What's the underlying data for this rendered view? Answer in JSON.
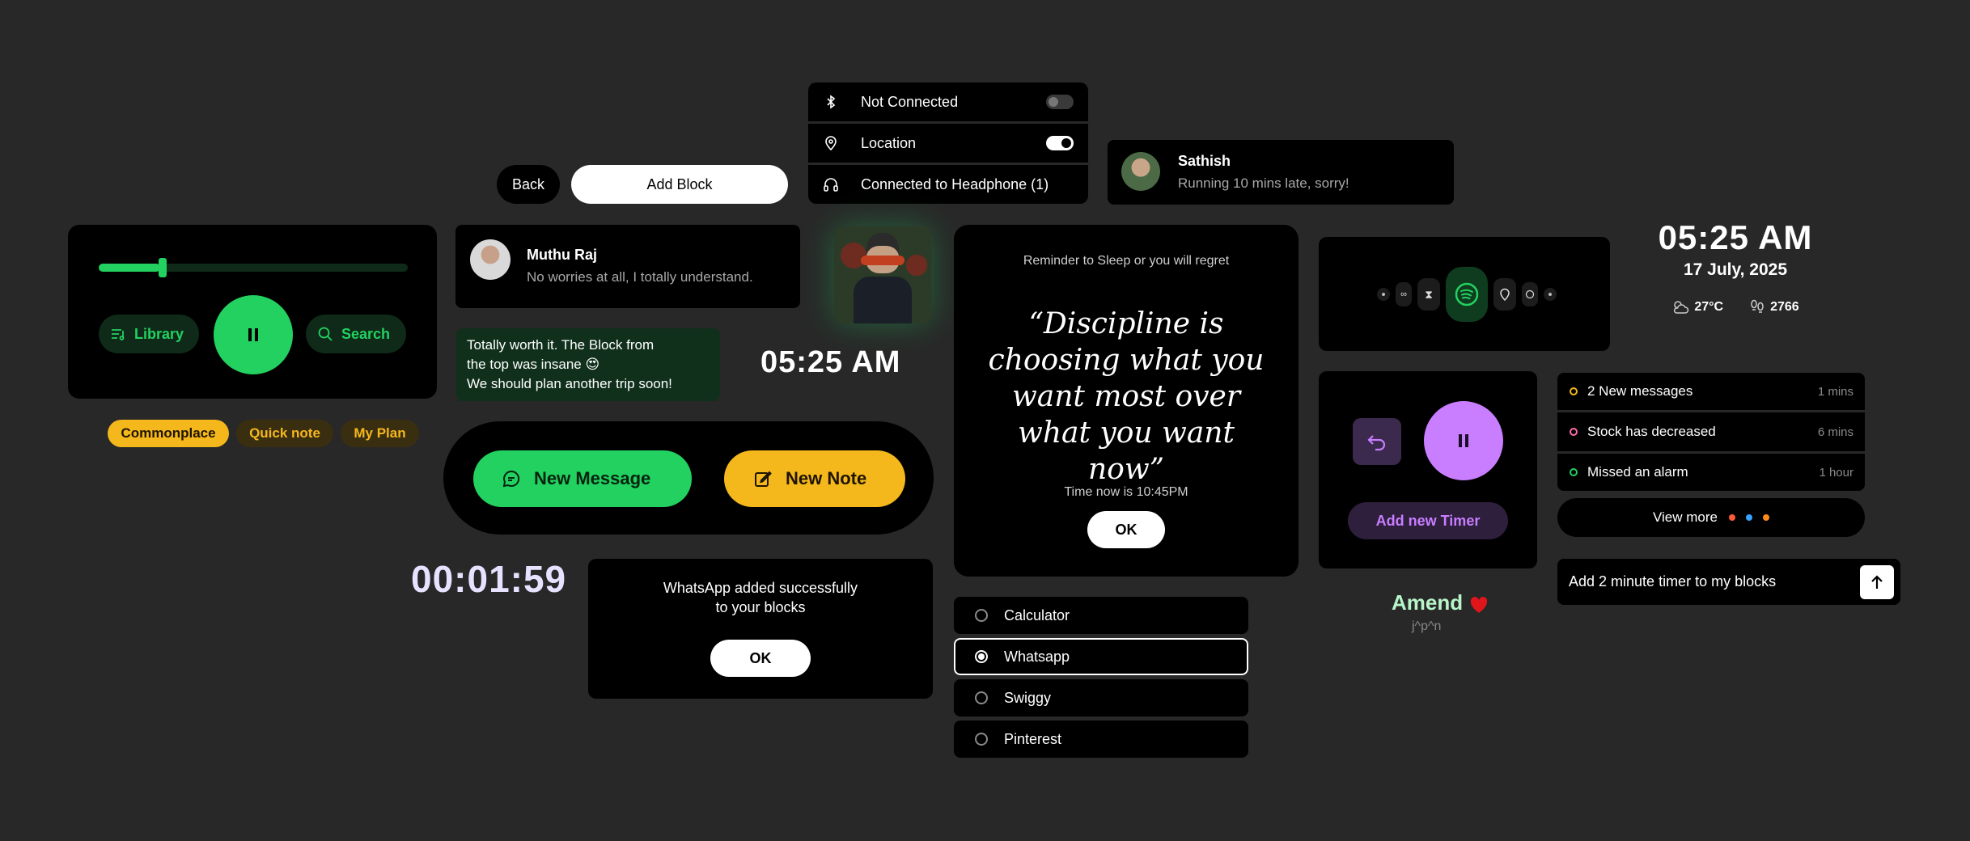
{
  "colors": {
    "accent_green": "#22d160",
    "accent_yellow": "#f5b81c",
    "accent_purple": "#c97dff",
    "bg": "#282828",
    "card": "#000000"
  },
  "top_buttons": {
    "back": "Back",
    "add_block": "Add Block"
  },
  "connectivity": {
    "items": [
      {
        "icon": "bluetooth-icon",
        "label": "Not Connected",
        "toggle": "off"
      },
      {
        "icon": "location-pin-icon",
        "label": "Location",
        "toggle": "on"
      },
      {
        "icon": "headphone-icon",
        "label": "Connected to Headphone (1)"
      }
    ]
  },
  "notification_top": {
    "name": "Sathish",
    "message": "Running 10 mins late, sorry!"
  },
  "music_player": {
    "progress": 0.2,
    "library_label": "Library",
    "search_label": "Search"
  },
  "tags": [
    "Commonplace",
    "Quick note",
    "My Plan"
  ],
  "message_card": {
    "name": "Muthu Raj",
    "message": "No worries at all, I totally understand."
  },
  "green_note": {
    "line1": "Totally worth it. The Block from",
    "line2": "the top was insane 😍",
    "line3": "We should plan another trip soon!"
  },
  "clock_small": "05:25 AM",
  "actions": {
    "new_message": "New Message",
    "new_note": "New Note"
  },
  "stopwatch": "00:01:59",
  "whatsapp_dialog": {
    "line1": "WhatsApp added successfully",
    "line2": "to your blocks",
    "ok": "OK"
  },
  "reminder": {
    "header": "Reminder to Sleep or you will regret",
    "quote": "“Discipline is choosing what you want most over what you want now”",
    "time_text": "Time now is 10:45PM",
    "ok": "OK"
  },
  "app_list": {
    "items": [
      "Calculator",
      "Whatsapp",
      "Swiggy",
      "Pinterest"
    ],
    "selected": "Whatsapp"
  },
  "dock": {
    "icons": [
      "dot-icon",
      "infinity-icon",
      "hourglass-icon",
      "spotify-icon",
      "location-icon",
      "whatsapp-icon",
      "dot-icon"
    ]
  },
  "timer_card": {
    "add_label": "Add new Timer"
  },
  "amend": {
    "title": "Amend",
    "subtitle": "j^p^n"
  },
  "clock_large": {
    "time": "05:25 AM",
    "date": "17 July, 2025",
    "temp": "27°C",
    "steps": "2766"
  },
  "notif_list": {
    "items": [
      {
        "label": "2 New messages",
        "time": "1 mins",
        "color": "#f5b81c"
      },
      {
        "label": "Stock has decreased",
        "time": "6 mins",
        "color": "#ff6fa8"
      },
      {
        "label": "Missed an alarm",
        "time": "1 hour",
        "color": "#22d160"
      }
    ],
    "view_more": "View more",
    "dots": [
      "#ff5a36",
      "#36a3ff",
      "#ff8a1c"
    ]
  },
  "prompt_input": {
    "value": "Add 2 minute timer to my blocks"
  }
}
